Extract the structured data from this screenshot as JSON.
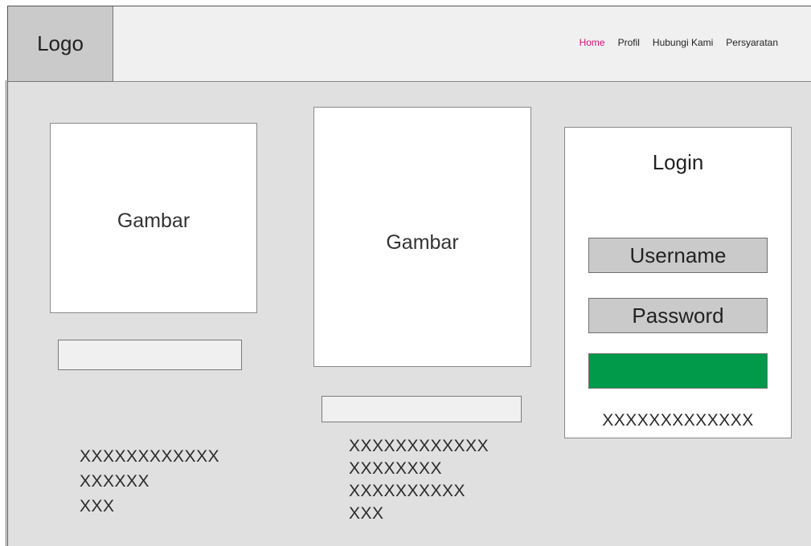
{
  "header": {
    "logo": "Logo",
    "nav": [
      {
        "label": "Home",
        "active": true
      },
      {
        "label": "Profil",
        "active": false
      },
      {
        "label": "Hubungi Kami",
        "active": false
      },
      {
        "label": "Persyaratan",
        "active": false
      }
    ],
    "active_color": "#d4147c"
  },
  "cards": [
    {
      "image_label": "Gambar",
      "text_lines": [
        "XXXXXXXXXXXX",
        "XXXXXX",
        "XXX"
      ]
    },
    {
      "image_label": "Gambar",
      "text_lines": [
        "XXXXXXXXXXXX",
        "XXXXXXXX",
        "XXXXXXXXXX",
        "XXX"
      ]
    }
  ],
  "login": {
    "title": "Login",
    "username_placeholder": "Username",
    "password_placeholder": "Password",
    "submit_color": "#009a4a",
    "footer": "XXXXXXXXXXXXX"
  }
}
